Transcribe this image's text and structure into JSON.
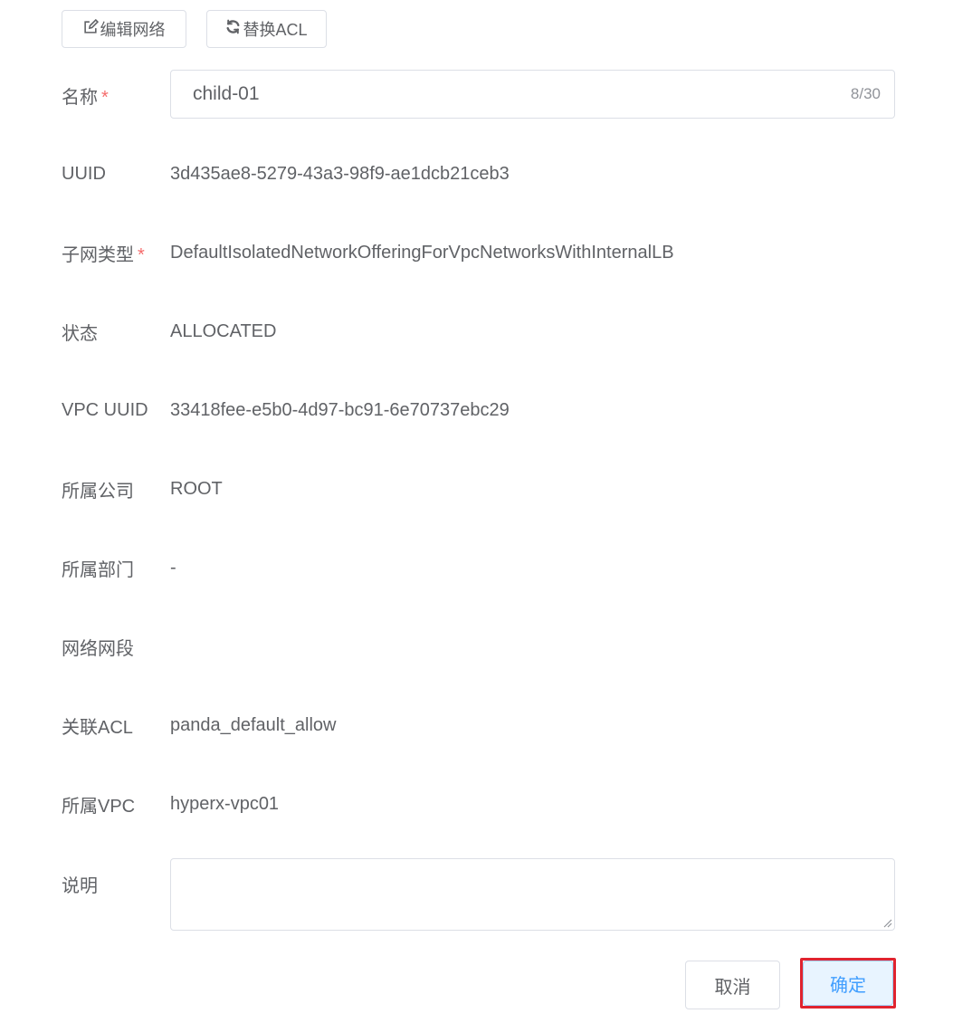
{
  "toolbar": {
    "edit_network_label": "编辑网络",
    "replace_acl_label": "替换ACL"
  },
  "form": {
    "name": {
      "label": "名称",
      "required_mark": "*",
      "value": "child-01",
      "char_count": "8/30"
    },
    "uuid": {
      "label": "UUID",
      "value": "3d435ae8-5279-43a3-98f9-ae1dcb21ceb3"
    },
    "subnet_type": {
      "label": "子网类型",
      "required_mark": "*",
      "value": "DefaultIsolatedNetworkOfferingForVpcNetworksWithInternalLB"
    },
    "status": {
      "label": "状态",
      "value": "ALLOCATED"
    },
    "vpc_uuid": {
      "label": "VPC UUID",
      "value": "33418fee-e5b0-4d97-bc91-6e70737ebc29"
    },
    "company": {
      "label": "所属公司",
      "value": "ROOT"
    },
    "department": {
      "label": "所属部门",
      "value": "-"
    },
    "network_segment": {
      "label": "网络网段",
      "value": ""
    },
    "acl": {
      "label": "关联ACL",
      "value": "panda_default_allow"
    },
    "vpc": {
      "label": "所属VPC",
      "value": "hyperx-vpc01"
    },
    "description": {
      "label": "说明",
      "value": ""
    }
  },
  "footer": {
    "cancel_label": "取消",
    "confirm_label": "确定"
  },
  "icons": {
    "edit": "edit-icon",
    "refresh": "refresh-icon"
  },
  "colors": {
    "required": "#f56c6c",
    "primary": "#409eff",
    "highlight_border": "#e0242f"
  }
}
